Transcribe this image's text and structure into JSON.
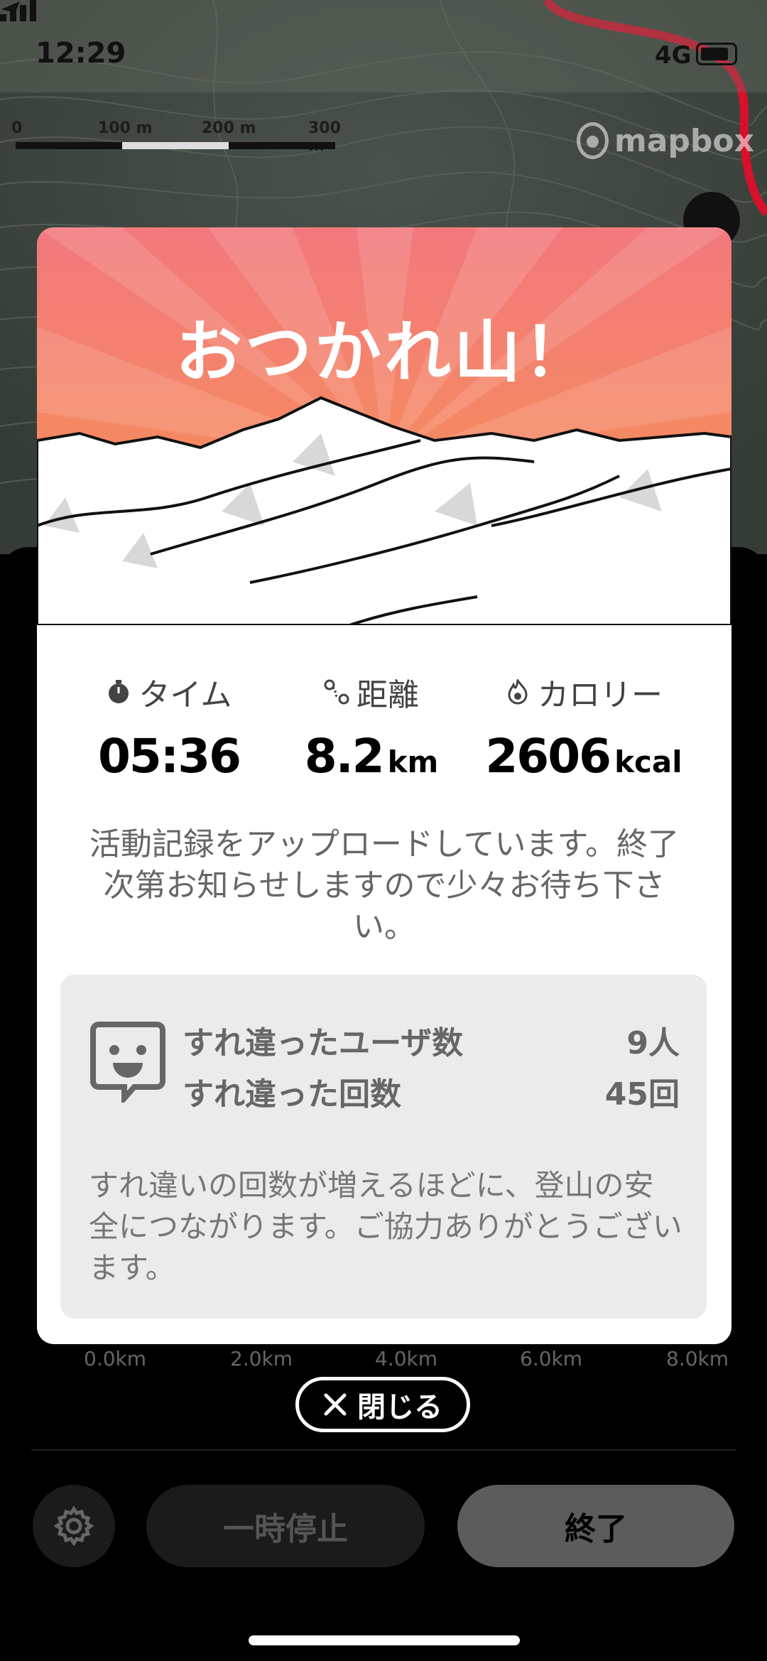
{
  "status_bar": {
    "time": "12:29",
    "network": "4G"
  },
  "map": {
    "scale_labels": [
      "0",
      "100 m",
      "200 m",
      "300 m"
    ],
    "attribution": "mapbox",
    "colors": {
      "route": "#d8102b",
      "terrain": "#3f4740"
    }
  },
  "card": {
    "title": "おつかれ山！",
    "stats": [
      {
        "icon": "stopwatch-icon",
        "label": "タイム",
        "value": "05:36",
        "unit": ""
      },
      {
        "icon": "route-icon",
        "label": "距離",
        "value": "8.2",
        "unit": "km"
      },
      {
        "icon": "flame-icon",
        "label": "カロリー",
        "value": "2606",
        "unit": "kcal"
      }
    ],
    "upload_message": "活動記録をアップロードしています。終了次第お知らせしますので少々お待ち下さい。",
    "passing": {
      "icon": "passing-face-icon",
      "users_label": "すれ違ったユーザ数",
      "users_value": "9人",
      "count_label": "すれ違った回数",
      "count_value": "45回",
      "note": "すれ違いの回数が増えるほどに、登山の安全につながります。ご協力ありがとうございます。"
    },
    "colors": {
      "sunburst_top": "#f37b7f",
      "sunburst_bottom": "#f99a4a"
    }
  },
  "elevation_axis": [
    "0.0km",
    "2.0km",
    "4.0km",
    "6.0km",
    "8.0km"
  ],
  "close_button": {
    "label": "閉じる",
    "icon": "close-icon"
  },
  "controls": {
    "pause_label": "一時停止",
    "end_label": "終了",
    "settings_icon": "gear-icon"
  }
}
